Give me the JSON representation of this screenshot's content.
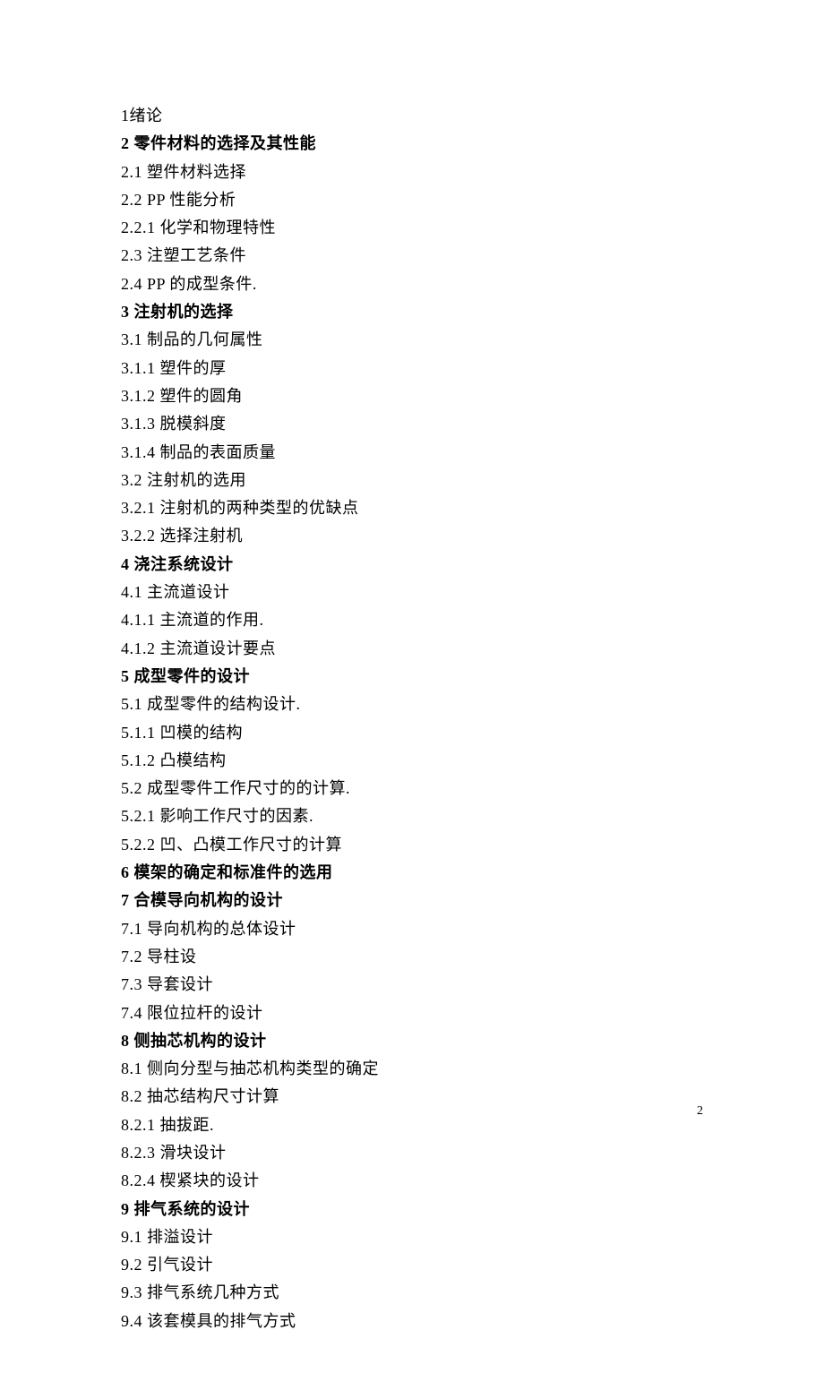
{
  "toc": [
    {
      "text": "1绪论",
      "bold": false
    },
    {
      "text": "2 零件材料的选择及其性能",
      "bold": true
    },
    {
      "text": "2.1 塑件材料选择",
      "bold": false
    },
    {
      "text": "2.2 PP 性能分析",
      "bold": false
    },
    {
      "text": "2.2.1 化学和物理特性",
      "bold": false
    },
    {
      "text": "2.3 注塑工艺条件",
      "bold": false
    },
    {
      "text": "2.4 PP 的成型条件.",
      "bold": false
    },
    {
      "text": "3 注射机的选择",
      "bold": true
    },
    {
      "text": "3.1 制品的几何属性",
      "bold": false
    },
    {
      "text": "3.1.1 塑件的厚",
      "bold": false
    },
    {
      "text": "3.1.2 塑件的圆角",
      "bold": false
    },
    {
      "text": "3.1.3 脱模斜度",
      "bold": false
    },
    {
      "text": "3.1.4 制品的表面质量",
      "bold": false
    },
    {
      "text": "3.2 注射机的选用",
      "bold": false
    },
    {
      "text": "3.2.1 注射机的两种类型的优缺点",
      "bold": false
    },
    {
      "text": "3.2.2 选择注射机",
      "bold": false
    },
    {
      "text": "4 浇注系统设计",
      "bold": true
    },
    {
      "text": "4.1 主流道设计",
      "bold": false
    },
    {
      "text": "4.1.1 主流道的作用.",
      "bold": false
    },
    {
      "text": "4.1.2 主流道设计要点",
      "bold": false
    },
    {
      "text": "5 成型零件的设计",
      "bold": true
    },
    {
      "text": "5.1 成型零件的结构设计.",
      "bold": false
    },
    {
      "text": "5.1.1 凹模的结构",
      "bold": false
    },
    {
      "text": "5.1.2 凸模结构",
      "bold": false
    },
    {
      "text": "5.2 成型零件工作尺寸的的计算.",
      "bold": false
    },
    {
      "text": "5.2.1 影响工作尺寸的因素.",
      "bold": false
    },
    {
      "text": "5.2.2 凹、凸模工作尺寸的计算",
      "bold": false
    },
    {
      "text": "6 模架的确定和标准件的选用",
      "bold": true
    },
    {
      "text": "7 合模导向机构的设计",
      "bold": true
    },
    {
      "text": "7.1 导向机构的总体设计",
      "bold": false
    },
    {
      "text": "7.2 导柱设",
      "bold": false
    },
    {
      "text": "7.3 导套设计",
      "bold": false
    },
    {
      "text": "7.4 限位拉杆的设计",
      "bold": false
    },
    {
      "text": "8 侧抽芯机构的设计",
      "bold": true
    },
    {
      "text": "8.1 侧向分型与抽芯机构类型的确定",
      "bold": false
    },
    {
      "text": "8.2 抽芯结构尺寸计算",
      "bold": false
    },
    {
      "text": "8.2.1 抽拔距.",
      "bold": false
    },
    {
      "text": "8.2.3 滑块设计",
      "bold": false
    },
    {
      "text": "8.2.4 楔紧块的设计",
      "bold": false
    },
    {
      "text": "9 排气系统的设计",
      "bold": true
    },
    {
      "text": "9.1 排溢设计",
      "bold": false
    },
    {
      "text": "9.2 引气设计",
      "bold": false
    },
    {
      "text": "9.3 排气系统几种方式",
      "bold": false
    },
    {
      "text": "9.4 该套模具的排气方式",
      "bold": false
    }
  ],
  "pageNumber": "2"
}
